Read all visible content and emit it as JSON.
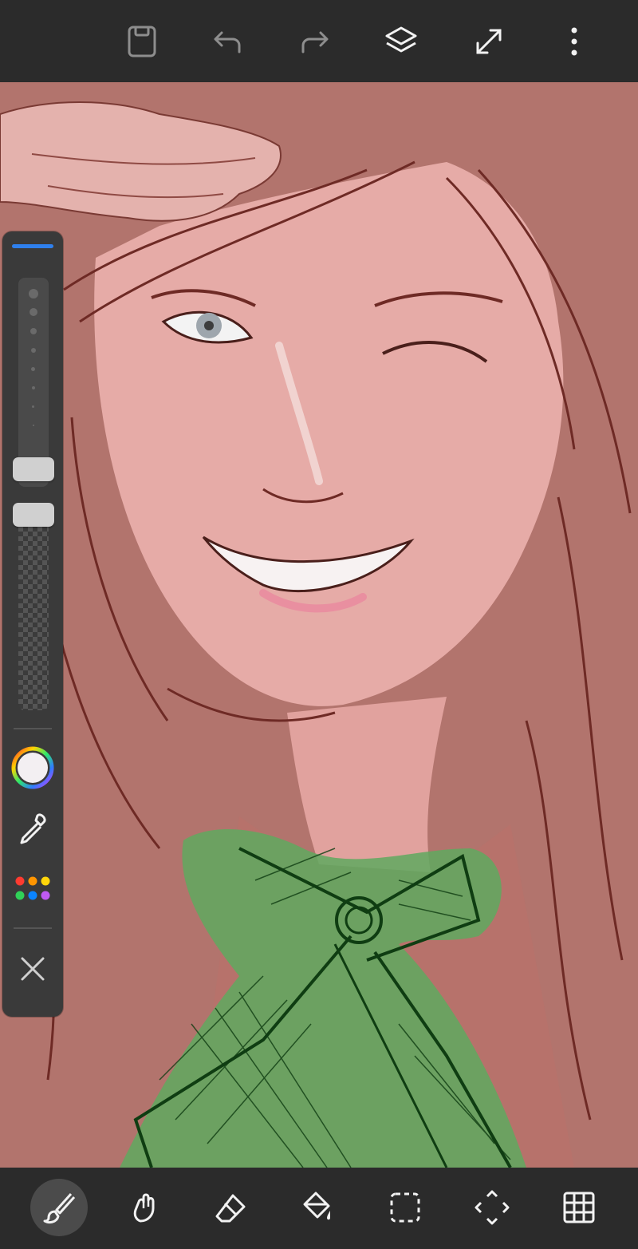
{
  "app": {
    "name": "drawing-app"
  },
  "toolbar_top": {
    "icons": [
      "save-icon",
      "undo-icon",
      "redo-icon",
      "layers-icon",
      "fullscreen-icon",
      "more-icon"
    ]
  },
  "toolbar_bottom": {
    "icons": [
      "brush-icon",
      "smudge-icon",
      "eraser-icon",
      "fill-icon",
      "selection-icon",
      "transform-icon",
      "grid-icon"
    ],
    "active": "brush-icon"
  },
  "side_panel": {
    "accent_color": "#2f80ed",
    "current_color": "#f3eff2",
    "palette_colors": [
      "#ff3b30",
      "#ff9500",
      "#ffd60a",
      "#30d158",
      "#0a84ff",
      "#bf5af2"
    ],
    "brush_size_level": 0.08,
    "brush_opacity_level": 0.97
  },
  "canvas": {
    "background": "#b2746d",
    "subject": "illustration"
  }
}
